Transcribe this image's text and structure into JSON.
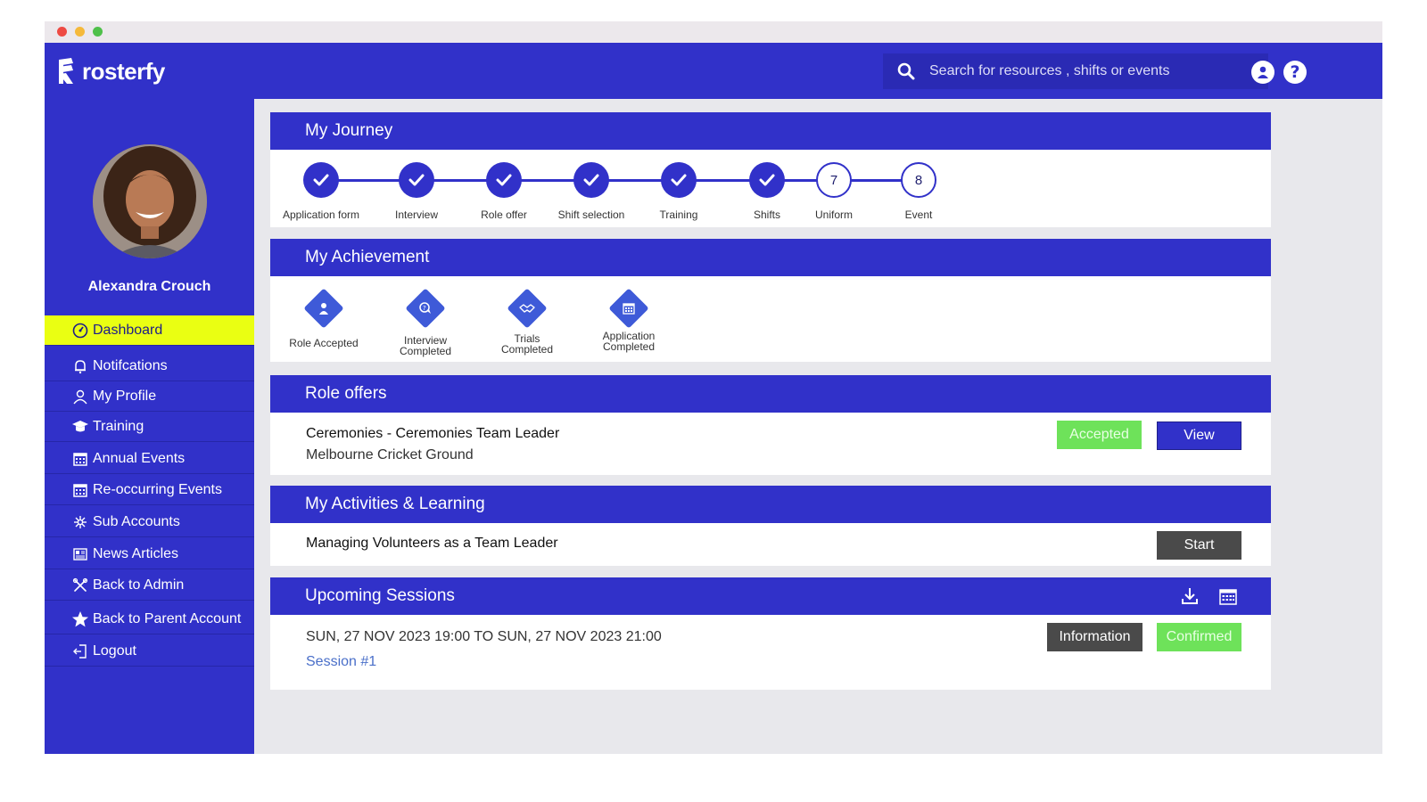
{
  "app": {
    "brand": "rosterfy"
  },
  "search": {
    "placeholder": "Search for resources , shifts or events"
  },
  "user": {
    "name": "Alexandra Crouch"
  },
  "nav": [
    {
      "label": "Dashboard",
      "icon": "dashboard-icon",
      "active": true
    },
    {
      "label": "Notifcations",
      "icon": "bell-icon"
    },
    {
      "label": "My Profile",
      "icon": "user-icon"
    },
    {
      "label": "Training",
      "icon": "graduation-cap-icon"
    },
    {
      "label": "Annual Events",
      "icon": "calendar-icon"
    },
    {
      "label": "Re-occurring Events",
      "icon": "calendar-icon"
    },
    {
      "label": "Sub Accounts",
      "icon": "network-icon"
    },
    {
      "label": "News Articles",
      "icon": "newspaper-icon"
    },
    {
      "label": "Back to Admin",
      "icon": "tools-icon"
    },
    {
      "label": "Back to Parent Account",
      "icon": "star-icon"
    },
    {
      "label": "Logout",
      "icon": "logout-icon"
    }
  ],
  "journey": {
    "title": "My Journey",
    "steps": [
      {
        "label": "Application form",
        "done": true
      },
      {
        "label": "Interview",
        "done": true
      },
      {
        "label": "Role offer",
        "done": true
      },
      {
        "label": "Shift selection",
        "done": true
      },
      {
        "label": "Training",
        "done": true
      },
      {
        "label": "Shifts",
        "done": true
      },
      {
        "label": "Uniform",
        "done": false,
        "number": "7"
      },
      {
        "label": "Event",
        "done": false,
        "number": "8"
      }
    ]
  },
  "achievements": {
    "title": "My Achievement",
    "items": [
      {
        "line1": "Role Accepted",
        "line2": "",
        "icon": "person-icon"
      },
      {
        "line1": "Interview",
        "line2": "Completed",
        "icon": "chat-icon"
      },
      {
        "line1": "Trials",
        "line2": "Completed",
        "icon": "handshake-icon"
      },
      {
        "line1": "Application",
        "line2": "Completed",
        "icon": "calendar-icon"
      }
    ]
  },
  "role_offers": {
    "title": "Role offers",
    "role": "Ceremonies - Ceremonies Team Leader",
    "location": "Melbourne Cricket Ground",
    "status": "Accepted",
    "view_label": "View"
  },
  "activities": {
    "title": "My Activities & Learning",
    "item": "Managing Volunteers as a Team Leader",
    "start_label": "Start"
  },
  "sessions": {
    "title": "Upcoming Sessions",
    "datetime": "SUN, 27 NOV 2023 19:00 TO SUN, 27 NOV 2023 21:00",
    "session_link": "Session #1",
    "info_label": "Information",
    "status": "Confirmed"
  },
  "colors": {
    "brand_blue": "#3131c9",
    "active_nav": "#eaff12",
    "accepted_green": "#6ee25a",
    "dark_button": "#4a4a4a",
    "link_blue": "#4a6fc9"
  }
}
